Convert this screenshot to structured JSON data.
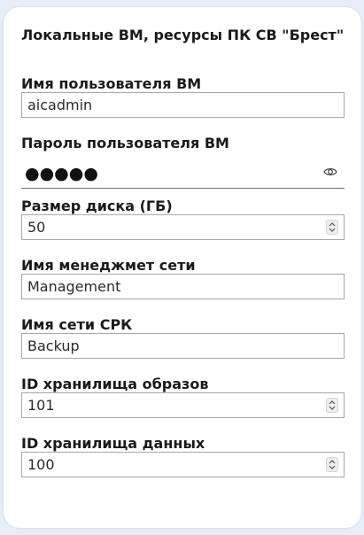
{
  "section": {
    "title": "Локальные ВМ, ресурсы ПК СВ \"Брест\""
  },
  "fields": {
    "username": {
      "label": "Имя пользователя ВМ",
      "value": "aicadmin"
    },
    "password": {
      "label": "Пароль пользователя ВМ",
      "masked_value": "●●●●●",
      "toggle_icon": "eye-icon"
    },
    "disk_size": {
      "label": "Размер диска (ГБ)",
      "value": "50"
    },
    "mgmt_network": {
      "label": "Имя менеджмет сети",
      "value": "Management"
    },
    "backup_network": {
      "label": "Имя сети СРК",
      "value": "Backup"
    },
    "image_storage_id": {
      "label": "ID хранилища образов",
      "value": "101"
    },
    "data_storage_id": {
      "label": "ID хранилища данных",
      "value": "100"
    }
  },
  "colors": {
    "page_background": "#e8eef8",
    "card_background": "#ffffff",
    "field_border": "#a8a8a8",
    "text": "#1a1a1a"
  }
}
